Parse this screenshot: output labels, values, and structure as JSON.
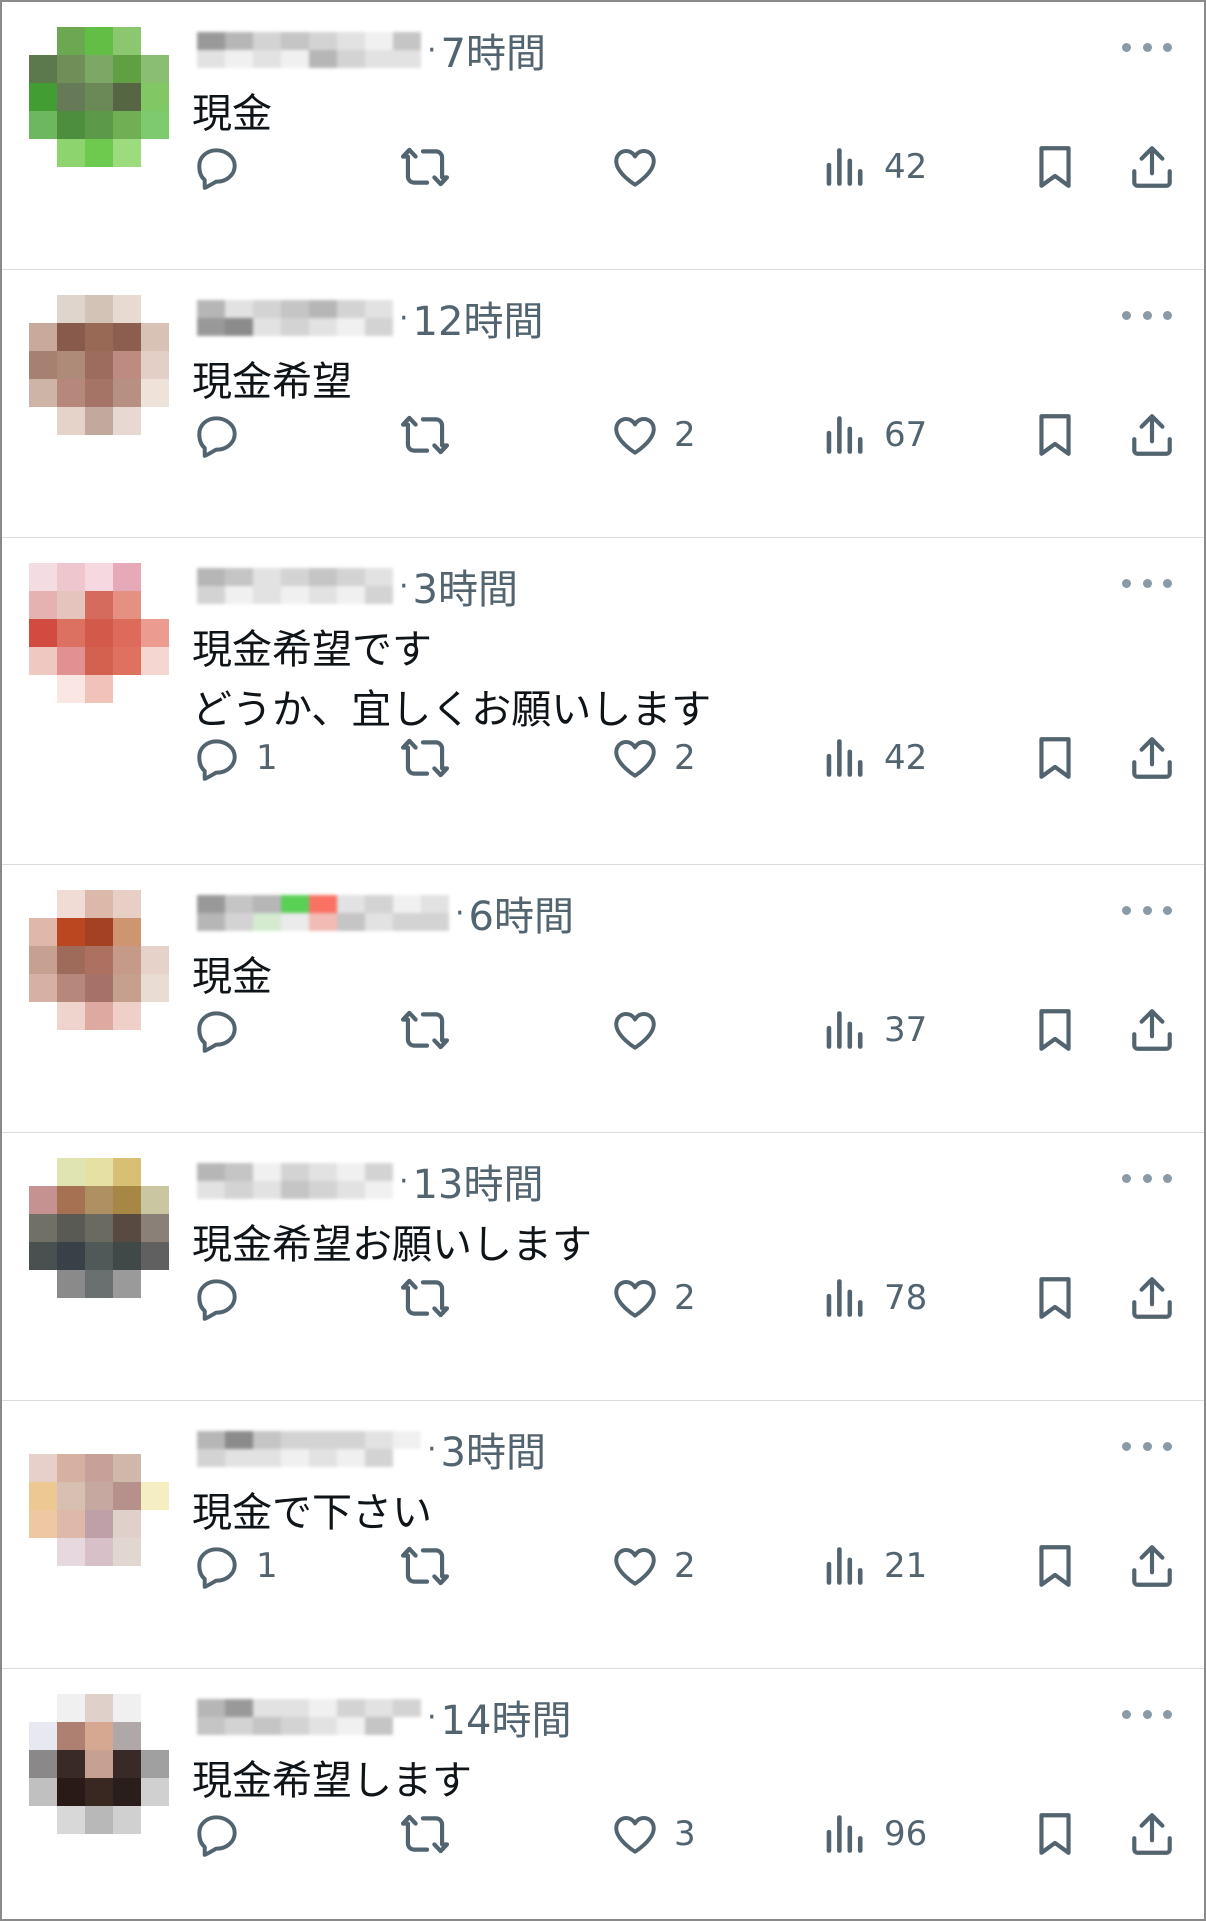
{
  "replies": [
    {
      "time": "7時間",
      "text": "現金",
      "comments": "",
      "likes": "",
      "views": "42",
      "avatar": [
        "#ffffff",
        "#6aa84f",
        "#5fbf3f",
        "#88c86a",
        "#ffffff",
        "#5a7a4a",
        "#6e8f56",
        "#7aa862",
        "#5fa03f",
        "#88c070",
        "#3f9f2f",
        "#667a55",
        "#6a8a55",
        "#556644",
        "#7fc85f",
        "#6ab85a",
        "#4a8f3a",
        "#5a9a45",
        "#6fb050",
        "#7acc6a",
        "#ffffff",
        "#8ad46a",
        "#6acc4a",
        "#9adc7a",
        "#ffffff"
      ],
      "name": [
        "#888",
        "#ddd",
        "#aaa",
        "#eee",
        "#ccc",
        "#ddd",
        "#bbb",
        "#eee",
        "#ccc",
        "#aaa",
        "#ddd",
        "#ccc",
        "#eee",
        "#ddd",
        "#bbb",
        "#ddd"
      ]
    },
    {
      "time": "12時間",
      "text": "現金希望",
      "comments": "",
      "likes": "2",
      "views": "67",
      "avatar": [
        "#ffffff",
        "#e0d5cc",
        "#d4c3b6",
        "#e8dbd0",
        "#ffffff",
        "#c9a99a",
        "#8a5a4a",
        "#9a6a55",
        "#8e5e4e",
        "#d9c2b4",
        "#a8806f",
        "#b08a78",
        "#a06a5e",
        "#c08a80",
        "#e4cfc4",
        "#cfb3a6",
        "#b8887a",
        "#a87266",
        "#b89082",
        "#f0e2d8",
        "#ffffff",
        "#e6d2c8",
        "#c4a89c",
        "#e8d8d0",
        "#ffffff"
      ],
      "name": [
        "#aaa",
        "#888",
        "#ddd",
        "#777",
        "#ccc",
        "#ddd",
        "#bbb",
        "#ccc",
        "#aaa",
        "#ddd",
        "#ccc",
        "#eee",
        "#ddd",
        "#ccc"
      ]
    },
    {
      "time": "3時間",
      "text": "現金希望です\nどうか、宜しくお願いします",
      "comments": "1",
      "likes": "2",
      "views": "42",
      "avatar": [
        "#f4dce2",
        "#f0c6ce",
        "#f6d8e0",
        "#e8a8b8",
        "#ffffff",
        "#e8b0b0",
        "#e6c4bc",
        "#d86a5a",
        "#e89080",
        "#ffffff",
        "#d84a3e",
        "#e07060",
        "#d85848",
        "#e26a5a",
        "#ee9a8e",
        "#f0c8c0",
        "#e49090",
        "#d8604e",
        "#e4705e",
        "#f6d6d0",
        "#ffffff",
        "#fbe6e2",
        "#f2c2b8",
        "#ffffff",
        "#ffffff"
      ],
      "name": [
        "#aaa",
        "#ccc",
        "#bbb",
        "#eee",
        "#ddd",
        "#ddd",
        "#ccc",
        "#eee",
        "#bbb",
        "#ddd",
        "#ccc",
        "#eee",
        "#ddd",
        "#ccc"
      ]
    },
    {
      "time": "6時間",
      "text": "現金",
      "comments": "",
      "likes": "",
      "views": "37",
      "avatar": [
        "#ffffff",
        "#f2dcd4",
        "#ddb8a8",
        "#e8cfc4",
        "#ffffff",
        "#e2b8aa",
        "#c0461e",
        "#a84020",
        "#d2946e",
        "#ffffff",
        "#c8a090",
        "#a06a5a",
        "#b07060",
        "#c89a88",
        "#e8d2c8",
        "#d8b0a4",
        "#b8887a",
        "#a87066",
        "#c8a08e",
        "#eadcd2",
        "#ffffff",
        "#f0d4cc",
        "#e0a8a0",
        "#f0d0c8",
        "#ffffff"
      ],
      "name": [
        "#888",
        "#aaa",
        "#bbb",
        "#ccc",
        "#aaa",
        "#cde8c8",
        "#3ec83a",
        "#e8e8e8",
        "#f85a4a",
        "#f0b0a8",
        "#ddd",
        "#bbb",
        "#ccc",
        "#ddd",
        "#eee",
        "#ccc",
        "#ddd",
        "#ccc"
      ]
    },
    {
      "time": "13時間",
      "text": "現金希望お願いします",
      "comments": "",
      "likes": "2",
      "views": "78",
      "avatar": [
        "#ffffff",
        "#e0e4b0",
        "#e8e0a0",
        "#d8c070",
        "#ffffff",
        "#c89090",
        "#a87050",
        "#b09060",
        "#a88840",
        "#cbc6a0",
        "#707066",
        "#5a5a55",
        "#6a6a60",
        "#5a4a40",
        "#8a8078",
        "#4a5050",
        "#3a4048",
        "#505858",
        "#404848",
        "#606060",
        "#ffffff",
        "#8a8a8a",
        "#6a7070",
        "#9a9a9a",
        "#ffffff"
      ],
      "name": [
        "#aaa",
        "#ddd",
        "#bbb",
        "#ccc",
        "#eee",
        "#ddd",
        "#ccc",
        "#bbb",
        "#ddd",
        "#ccc",
        "#eee",
        "#ddd",
        "#ccc",
        "#eee"
      ]
    },
    {
      "time": "3時間",
      "text": "現金で下さい",
      "comments": "1",
      "likes": "2",
      "views": "21",
      "avatar": [
        "#ffffff",
        "#ffffff",
        "#ffffff",
        "#ffffff",
        "#ffffff",
        "#e8d0c8",
        "#d8b0a0",
        "#c8a098",
        "#d0b8a8",
        "#ffffff",
        "#f0c890",
        "#d8c0b0",
        "#c8a8a0",
        "#b8908a",
        "#f4eec0",
        "#f0c8a0",
        "#e0b8a8",
        "#c0a0a8",
        "#e0d0c8",
        "#ffffff",
        "#ffffff",
        "#e8d8e0",
        "#d8c0c8",
        "#e0d8d0",
        "#ffffff"
      ],
      "name": [
        "#aaa",
        "#ccc",
        "#777",
        "#ddd",
        "#bbb",
        "#ddd",
        "#ccc",
        "#eee",
        "#ccc",
        "#ddd",
        "#ccc",
        "#eee",
        "#ddd",
        "#ccc",
        "#eee"
      ]
    },
    {
      "time": "14時間",
      "text": "現金希望します",
      "comments": "",
      "likes": "3",
      "views": "96",
      "avatar": [
        "#ffffff",
        "#f0f0f0",
        "#e0d0c8",
        "#f0f0f0",
        "#ffffff",
        "#e8e8f0",
        "#b08070",
        "#d8a890",
        "#b0a8a8",
        "#ffffff",
        "#8a8888",
        "#3a2a28",
        "#c8a090",
        "#3a2a2a",
        "#a0a0a0",
        "#c0c0c0",
        "#2a1a18",
        "#3a2822",
        "#2a1e1c",
        "#d0d0d0",
        "#ffffff",
        "#d8d8d8",
        "#b8b8b8",
        "#d0d0d0",
        "#ffffff"
      ],
      "name": [
        "#aaa",
        "#bbb",
        "#888",
        "#ccc",
        "#ddd",
        "#bbb",
        "#ddd",
        "#ccc",
        "#eee",
        "#ddd",
        "#ccc",
        "#eee",
        "#ddd",
        "#bbb",
        "#ccc"
      ]
    }
  ]
}
